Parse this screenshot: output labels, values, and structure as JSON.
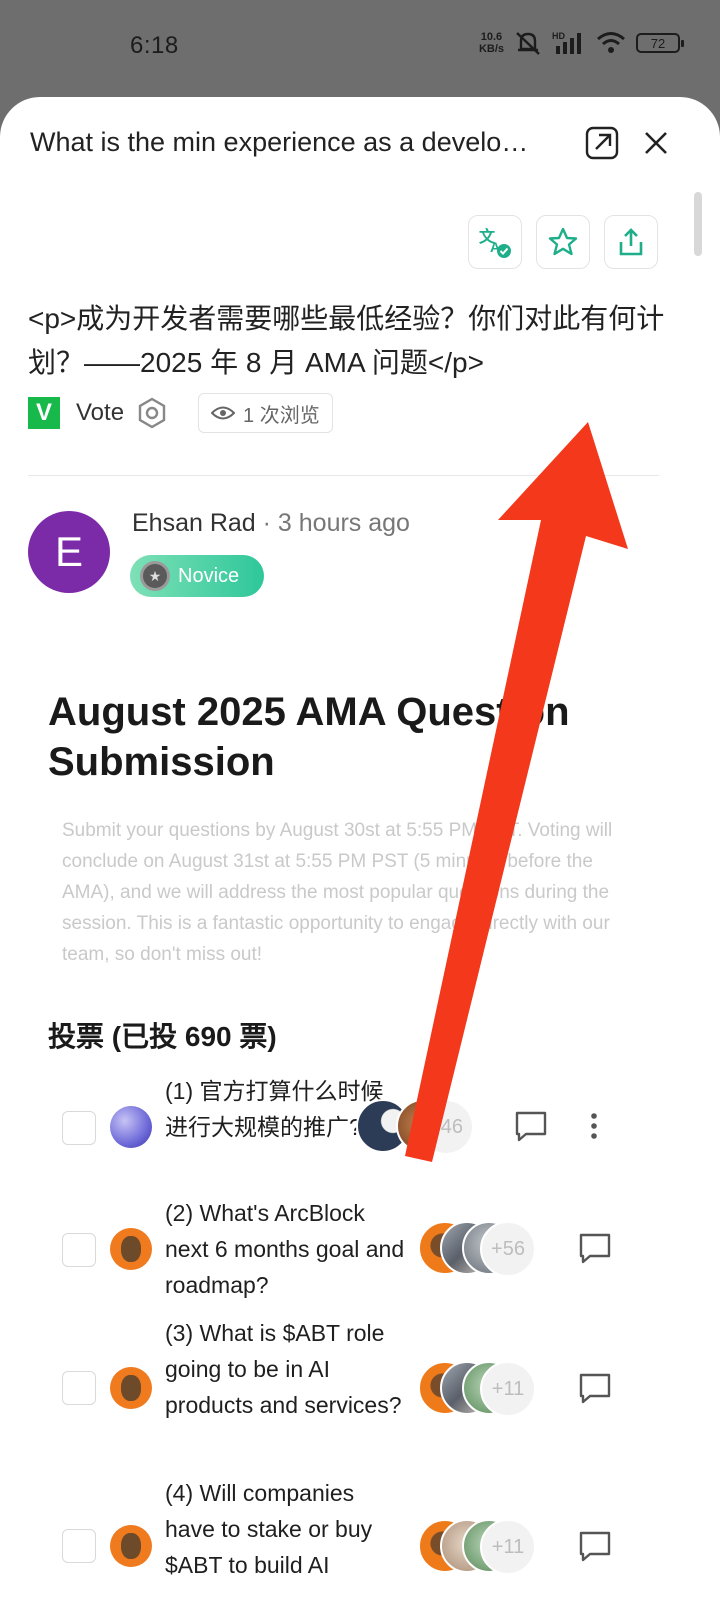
{
  "status": {
    "time": "6:18",
    "net_speed_top": "10.6",
    "net_speed_bottom": "KB/s",
    "network_label": "HD",
    "battery": "72"
  },
  "header": {
    "title": "What is the min experience as a develo…"
  },
  "post": {
    "title": "<p>成为开发者需要哪些最低经验？你们对此有何计划？——2025 年 8 月 AMA 问题</p>",
    "vote_logo": "V",
    "vote_label": "Vote",
    "views": "1 次浏览"
  },
  "author": {
    "initial": "E",
    "name": "Ehsan Rad",
    "separator": " · ",
    "time": "3 hours ago",
    "badge": "Novice"
  },
  "content": {
    "heading": "August 2025 AMA Question Submission",
    "description": "Submit your questions by August 30st at 5:55 PM PST. Voting will conclude on August 31st at 5:55 PM PST (5 minutes before the AMA), and we will address the most popular questions during the session. This is a fantastic opportunity to engage directly with our team, so don't miss out!",
    "votes_heading": "投票 (已投 690 票)"
  },
  "vote_items": [
    {
      "text": "(1) 官方打算什么时候进行大规模的推广?",
      "more_count": "+46"
    },
    {
      "text": "(2) What's ArcBlock next 6 months goal and roadmap?",
      "more_count": "+56"
    },
    {
      "text": "(3) What is $ABT role going to be in AI products and services?",
      "more_count": "+11"
    },
    {
      "text": "(4) Will companies have to stake or buy $ABT to build AI",
      "more_count": "+11"
    }
  ],
  "colors": {
    "accent": "#17b94a",
    "icon_teal": "#1fae8a",
    "arrow": "#f4381c",
    "author_avatar": "#7b2aa8"
  }
}
